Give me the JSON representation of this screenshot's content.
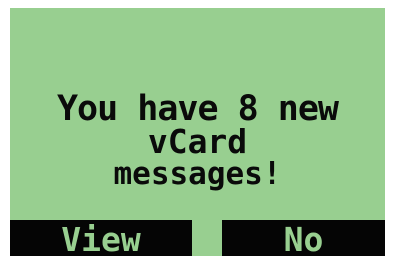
{
  "screen": {
    "message_lines": [
      "You have 8 new",
      "vCard",
      "messages!"
    ]
  },
  "softkeys": {
    "left_label": "View",
    "right_label": "No"
  },
  "colors": {
    "display_background": "#98cf90",
    "text": "#0a0a0a",
    "softkey_background": "#050505",
    "softkey_text": "#98cf90"
  }
}
